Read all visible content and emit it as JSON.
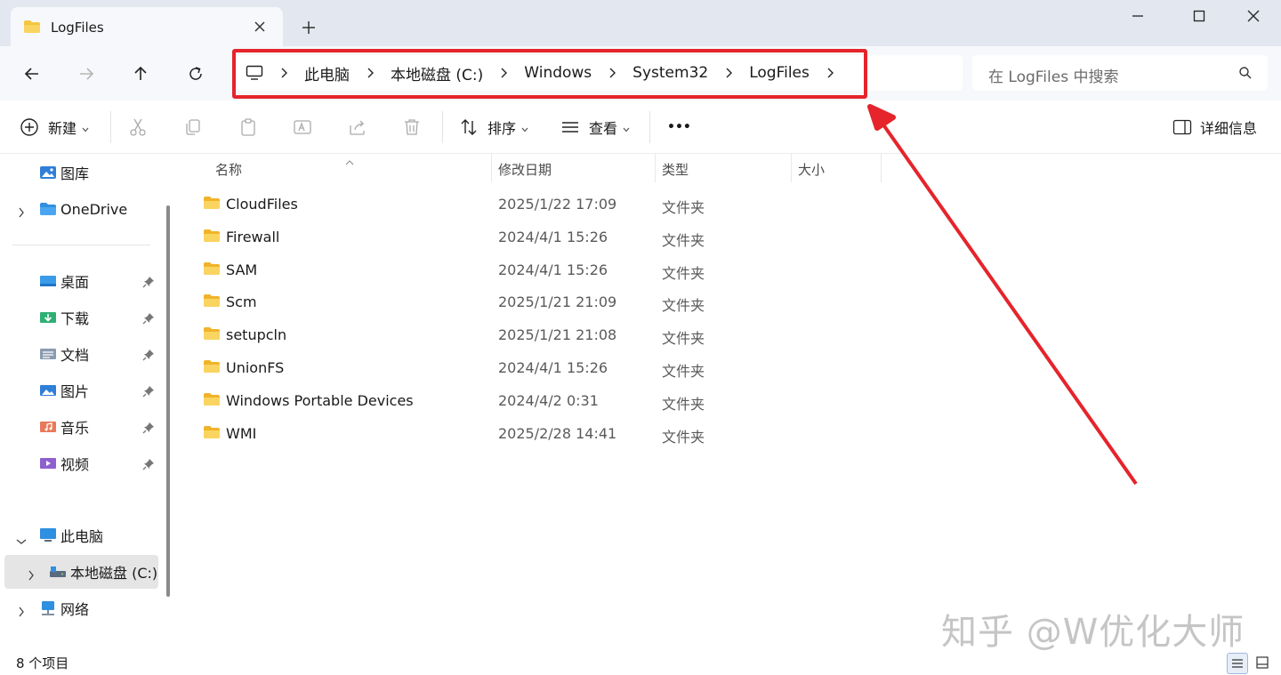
{
  "tab": {
    "title": "LogFiles",
    "close_symbol": "✕",
    "new_tab_symbol": "+"
  },
  "window": {
    "minimize": "—",
    "maximize": "☐",
    "close": "✕"
  },
  "breadcrumbs": [
    "此电脑",
    "本地磁盘 (C:)",
    "Windows",
    "System32",
    "LogFiles"
  ],
  "search": {
    "placeholder": "在 LogFiles 中搜索"
  },
  "toolbar": {
    "new_label": "新建",
    "sort_label": "排序",
    "view_label": "查看",
    "more_label": "•••",
    "details_label": "详细信息"
  },
  "sidebar": {
    "gallery": "图库",
    "onedrive": "OneDrive",
    "quick": [
      "桌面",
      "下载",
      "文档",
      "图片",
      "音乐",
      "视频"
    ],
    "this_pc": "此电脑",
    "local_disk": "本地磁盘 (C:)",
    "network": "网络"
  },
  "columns": {
    "name": "名称",
    "modified": "修改日期",
    "type": "类型",
    "size": "大小"
  },
  "files": [
    {
      "name": "CloudFiles",
      "date": "2025/1/22 17:09",
      "type": "文件夹"
    },
    {
      "name": "Firewall",
      "date": "2024/4/1 15:26",
      "type": "文件夹"
    },
    {
      "name": "SAM",
      "date": "2024/4/1 15:26",
      "type": "文件夹"
    },
    {
      "name": "Scm",
      "date": "2025/1/21 21:09",
      "type": "文件夹"
    },
    {
      "name": "setupcln",
      "date": "2025/1/21 21:08",
      "type": "文件夹"
    },
    {
      "name": "UnionFS",
      "date": "2024/4/1 15:26",
      "type": "文件夹"
    },
    {
      "name": "Windows Portable Devices",
      "date": "2024/4/2 0:31",
      "type": "文件夹"
    },
    {
      "name": "WMI",
      "date": "2025/2/28 14:41",
      "type": "文件夹"
    }
  ],
  "status": {
    "count": "8 个项目"
  },
  "watermark": "知乎 @W优化大师",
  "colors": {
    "highlight": "#e5242b",
    "folder": "#f5c542",
    "titlebar": "#e3e8f0",
    "navbar": "#f6f8fb"
  }
}
